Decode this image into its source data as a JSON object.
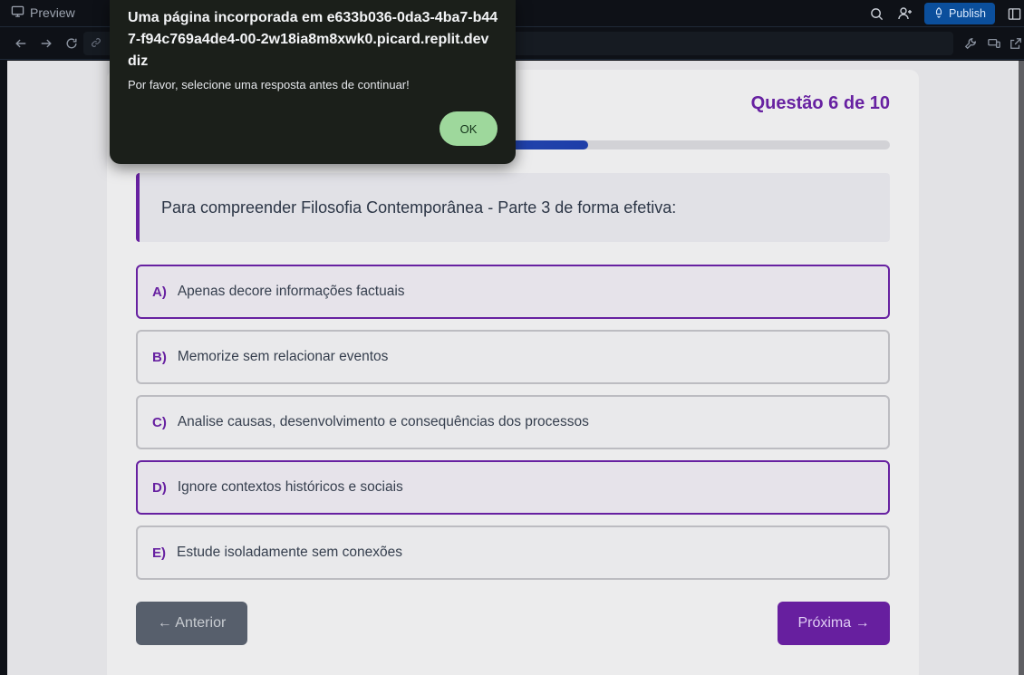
{
  "topbar": {
    "preview_label": "Preview",
    "publish_label": "Publish"
  },
  "quiz": {
    "counter": "Questão 6 de 10",
    "progress": 0.6,
    "question": "Para compreender Filosofia Contemporânea - Parte 3 de forma efetiva:",
    "options": [
      {
        "letter": "A)",
        "text": "Apenas decore informações factuais",
        "selected": true
      },
      {
        "letter": "B)",
        "text": "Memorize sem relacionar eventos",
        "selected": false
      },
      {
        "letter": "C)",
        "text": "Analise causas, desenvolvimento e consequências dos processos",
        "selected": false
      },
      {
        "letter": "D)",
        "text": "Ignore contextos históricos e sociais",
        "selected": true
      },
      {
        "letter": "E)",
        "text": "Estude isoladamente sem conexões",
        "selected": false
      }
    ],
    "prev_label": "← Anterior",
    "next_label": "Próxima →"
  },
  "dialog": {
    "title": "Uma página incorporada em e633b036-0da3-4ba7-b447-f94c769a4de4-00-2w18ia8m8xwk0.picard.replit.dev diz",
    "message": "Por favor, selecione uma resposta antes de continuar!",
    "ok_label": "OK"
  },
  "colors": {
    "accent_purple": "#6b21a8",
    "progress_blue": "#1e40af",
    "ok_green": "#9ed89c",
    "publish_blue": "#0b4f9c"
  }
}
